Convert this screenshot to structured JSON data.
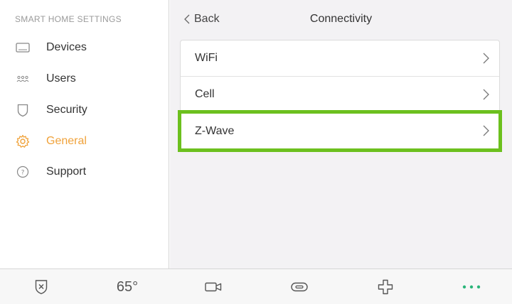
{
  "sidebar": {
    "title": "SMART HOME SETTINGS",
    "items": [
      {
        "label": "Devices",
        "icon": "tablet-icon"
      },
      {
        "label": "Users",
        "icon": "users-icon"
      },
      {
        "label": "Security",
        "icon": "shield-icon"
      },
      {
        "label": "General",
        "icon": "gear-icon",
        "active": true
      },
      {
        "label": "Support",
        "icon": "question-icon"
      }
    ]
  },
  "header": {
    "back_label": "Back",
    "title": "Connectivity"
  },
  "list": {
    "items": [
      {
        "label": "WiFi"
      },
      {
        "label": "Cell"
      },
      {
        "label": "Z-Wave",
        "highlighted": true
      }
    ]
  },
  "tabbar": {
    "temperature": "65°",
    "icons": [
      "shield-x-icon",
      "temperature",
      "camera-icon",
      "lock-pill-icon",
      "plus-cross-icon",
      "more-dots-icon"
    ]
  },
  "colors": {
    "accent": "#f0a23a",
    "highlight": "#6cc01e",
    "more_dots": "#2bb57a"
  }
}
